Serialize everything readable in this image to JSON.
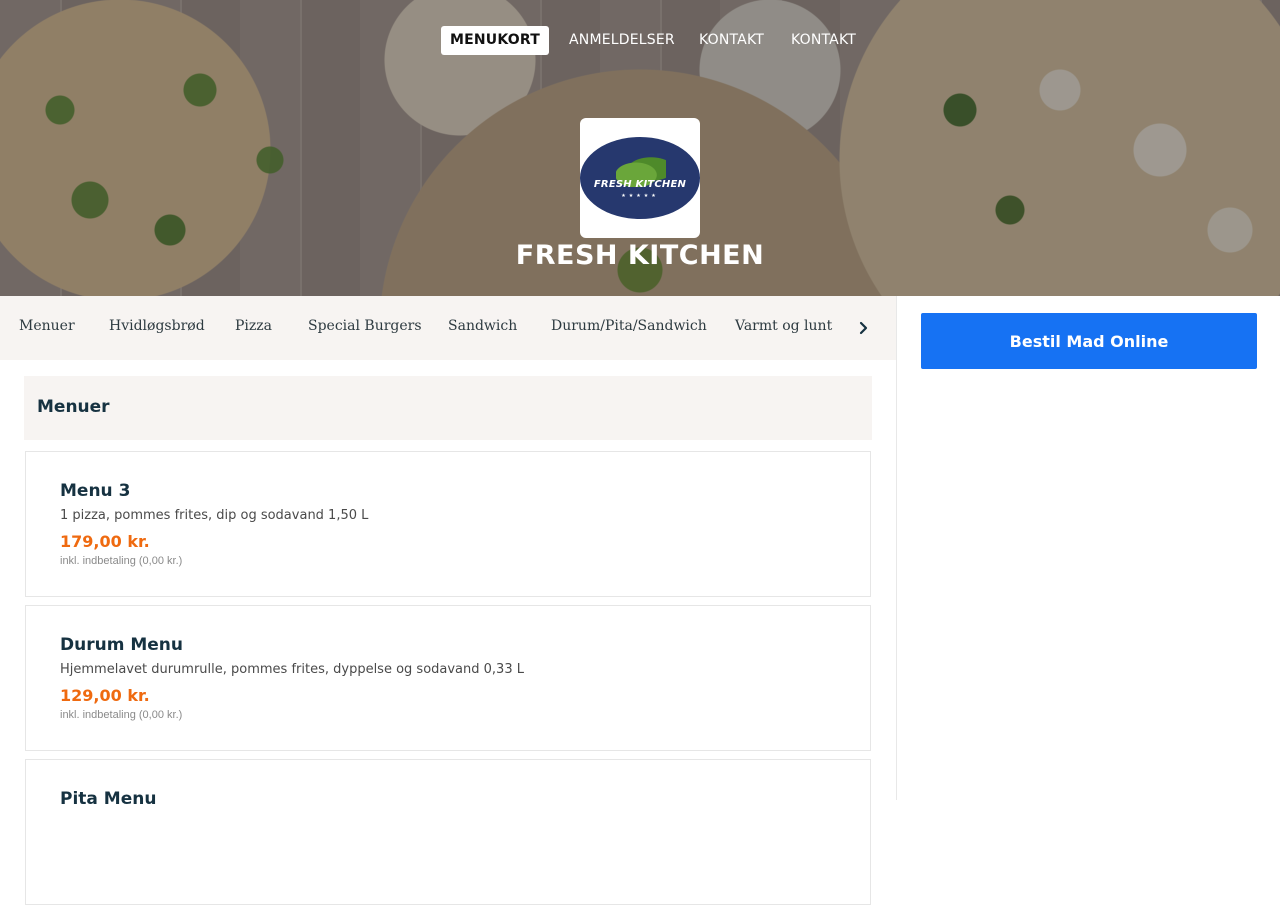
{
  "nav": {
    "items": [
      {
        "label": "MENUKORT",
        "active": true
      },
      {
        "label": "ANMELDELSER",
        "active": false
      },
      {
        "label": "KONTAKT",
        "active": false
      },
      {
        "label": "KONTAKT",
        "active": false
      }
    ]
  },
  "brand": {
    "logo_text": "FRESH KITCHEN",
    "logo_stars": "★★★★★",
    "title": "FRESH KITCHEN",
    "logo_colors": {
      "oval": "#26386e",
      "leaf": "#5a9a33"
    }
  },
  "categories": {
    "items": [
      "Menuer",
      "Hvidløgsbrød",
      "Pizza",
      "Special Burgers",
      "Sandwich",
      "Durum/Pita/Sandwich",
      "Varmt og lunt"
    ],
    "next_icon": "chevron-right-icon"
  },
  "section": {
    "title": "Menuer",
    "items": [
      {
        "name": "Menu 3",
        "description": "1 pizza, pommes frites, dip og sodavand 1,50 L",
        "price": "179,00 kr.",
        "note": "inkl. indbetaling (0,00 kr.)"
      },
      {
        "name": "Durum Menu",
        "description": "Hjemmelavet durumrulle, pommes frites, dyppelse og sodavand 0,33 L",
        "price": "129,00 kr.",
        "note": "inkl. indbetaling (0,00 kr.)"
      },
      {
        "name": "Pita Menu",
        "description": "",
        "price": "",
        "note": ""
      }
    ]
  },
  "sidebar": {
    "order_button": "Bestil Mad Online"
  },
  "colors": {
    "accent_blue": "#1672f3",
    "price_orange": "#ef6a10",
    "heading_navy": "#163241",
    "category_bg": "#f7f4f2"
  }
}
